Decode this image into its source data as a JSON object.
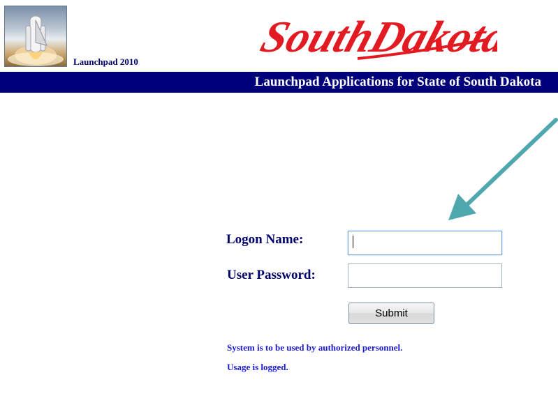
{
  "header": {
    "app_name": "Launchpad 2010",
    "brand_text": "SouthDakota",
    "banner_title": "Launchpad Applications for State of South Dakota"
  },
  "form": {
    "logon_label": "Logon Name:",
    "logon_value": "",
    "password_label": "User Password:",
    "password_value": "",
    "submit_label": "Submit"
  },
  "notice": {
    "line1": "System is to be used by authorized personnel.",
    "line2": "Usage is logged."
  },
  "colors": {
    "banner": "#00007a",
    "brand_red": "#e21b23",
    "label": "#00006b",
    "notice": "#1a1ad6",
    "arrow": "#4fa8ad"
  }
}
